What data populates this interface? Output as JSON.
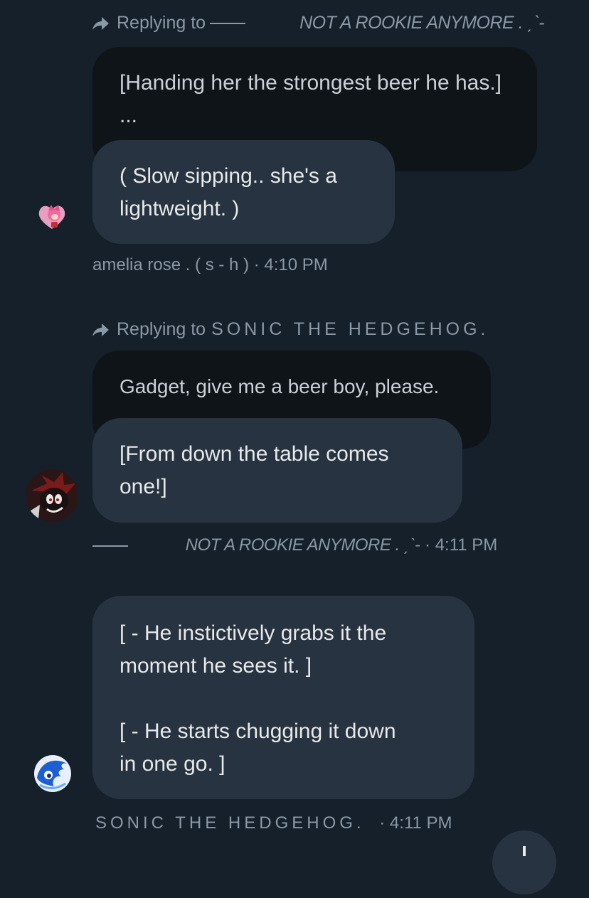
{
  "messages": [
    {
      "reply": {
        "prefix": "Replying to",
        "name": "NOT A ROOKIE ANYMORE . ˏˋ-"
      },
      "quoted_text": "[Handing her the strongest beer he has.]\n...",
      "text": "( Slow sipping.. she's a\nlightweight. )",
      "avatar_icon": "pink-hedgehog-avatar-icon",
      "meta": "amelia rose . ( s - h ) · 4:10 PM"
    },
    {
      "reply": {
        "prefix": "Replying to",
        "name": "SONIC THE HEDGEHOG."
      },
      "quoted_text": "Gadget, give me a beer boy, please.",
      "text": "[From down the table comes\none!]",
      "avatar_icon": "dark-hedgehog-avatar-icon",
      "meta_name": "NOT A ROOKIE ANYMORE . ˏˋ-",
      "meta_time": "· 4:11 PM"
    },
    {
      "text": "[ - He instictively grabs it the\nmoment he sees it. ]\n\n[ - He starts chugging it down\nin one go. ]",
      "avatar_icon": "blue-hedgehog-avatar-icon",
      "meta_name": "SONIC THE HEDGEHOG.",
      "meta_time": "· 4:11 PM"
    }
  ],
  "colors": {
    "background": "#15202b",
    "bubble": "#273340",
    "quoted_bubble": "#0f1419",
    "muted_text": "#8b98a5"
  },
  "fab_icon": "plus-icon"
}
